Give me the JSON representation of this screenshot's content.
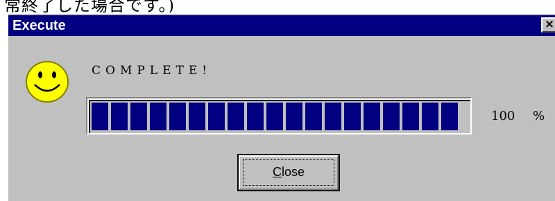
{
  "top_strip": {
    "text": "常終了した場合です。)"
  },
  "window": {
    "title": "Execute",
    "close_glyph": "×"
  },
  "status": {
    "message": "COMPLETE!",
    "icon": "smiley-face-icon"
  },
  "progress": {
    "percent_value": "100",
    "percent_sign": "%",
    "fraction": 1.0,
    "fill_color": "#000080"
  },
  "buttons": {
    "close_mnemonic": "C",
    "close_rest": "lose"
  },
  "colors": {
    "titlebar": "#000080",
    "face": "#c0c0c0",
    "smiley": "#ffff00"
  }
}
